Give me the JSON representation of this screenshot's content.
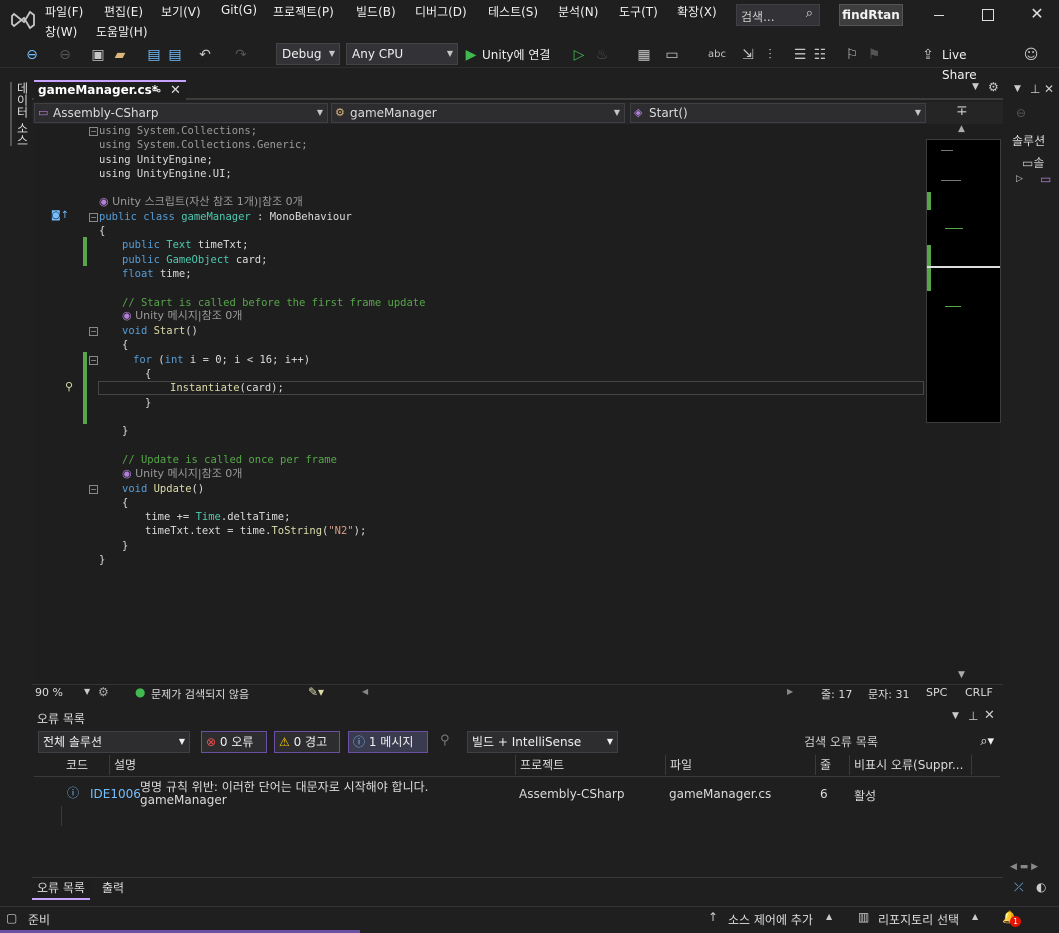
{
  "menus": {
    "file": "파일(F)",
    "edit": "편집(E)",
    "view": "보기(V)",
    "git": "Git(G)",
    "project": "프로젝트(P)",
    "build": "빌드(B)",
    "debug": "디버그(D)",
    "test": "테스트(S)",
    "analyze": "분석(N)",
    "tools": "도구(T)",
    "extensions": "확장(X)",
    "window": "창(W)",
    "help": "도움말(H)"
  },
  "search": {
    "placeholder": "검색..."
  },
  "solution_name": "findRtan",
  "toolbar": {
    "config": "Debug",
    "platform": "Any CPU",
    "run_label": "Unity에 연결",
    "live_share": "Live Share"
  },
  "left_tab": "데이터 소스",
  "document_tab": {
    "title": "gameManager.cs*"
  },
  "navbar": {
    "project": "Assembly-CSharp",
    "class": "gameManager",
    "member": "Start()"
  },
  "code": {
    "l1": "using System.Collections;",
    "l2": "using System.Collections.Generic;",
    "l3": "using UnityEngine;",
    "l4": "using UnityEngine.UI;",
    "hint1": "Unity 스크립트(자산 참조 1개)|참조 0개",
    "class_decl_kw": "public class ",
    "class_name": "gameManager",
    "class_base": " : MonoBehaviour",
    "brace_open": "{",
    "f1_kw": "public ",
    "f1_ty": "Text ",
    "f1_name": "timeTxt;",
    "f2_kw": "public ",
    "f2_ty": "GameObject ",
    "f2_name": "card;",
    "f3_kw": "float ",
    "f3_name": "time;",
    "comment1": "// Start is called before the first frame update",
    "hint2": "Unity 메시지|참조 0개",
    "start_kw": "void ",
    "start_fn": "Start",
    "start_paren": "()",
    "for_kw": "for ",
    "for_rest1": "(",
    "for_int": "int ",
    "for_rest2": "i = 0; i < 16; i++)",
    "inst_fn": "Instantiate",
    "inst_rest": "(card);",
    "brace_close": "}",
    "comment2": "// Update is called once per frame",
    "hint3": "Unity 메시지|참조 0개",
    "upd_kw": "void ",
    "upd_fn": "Update",
    "upd_paren": "()",
    "u1a": "time += ",
    "u1b": "Time",
    ".u1c": "",
    "u1c": ".deltaTime;",
    "u2a": "timeTxt.text = time.",
    "u2b": "ToString",
    "u2c": "(",
    "u2d": "\"N2\"",
    "u2e": ");"
  },
  "editor_status": {
    "zoom": "90 %",
    "issues": "문제가 검색되지 않음",
    "line": "줄: 17",
    "col": "문자: 31",
    "spc": "SPC",
    "eol": "CRLF"
  },
  "error_list": {
    "title": "오류 목록",
    "scope": "전체 솔루션",
    "errors": "0 오류",
    "warnings": "0 경고",
    "messages": "1 메시지",
    "source": "빌드 + IntelliSense",
    "search_placeholder": "검색 오류 목록",
    "headers": {
      "code": "코드",
      "desc": "설명",
      "project": "프로젝트",
      "file": "파일",
      "line": "줄",
      "suppress": "비표시 오류(Suppr..."
    },
    "rows": [
      {
        "code": "IDE1006",
        "desc1": "명명 규칙 위반: 이러한 단어는 대문자로 시작해야 합니다.",
        "desc2": "gameManager",
        "project": "Assembly-CSharp",
        "file": "gameManager.cs",
        "line": "6",
        "state": "활성"
      }
    ],
    "tab1": "오류 목록",
    "tab2": "출력"
  },
  "right_panel": {
    "title": "솔루션",
    "item": "솔"
  },
  "statusbar": {
    "ready": "준비",
    "source_control": "소스 제어에 추가",
    "repo": "리포지토리 선택",
    "notif": "1"
  }
}
